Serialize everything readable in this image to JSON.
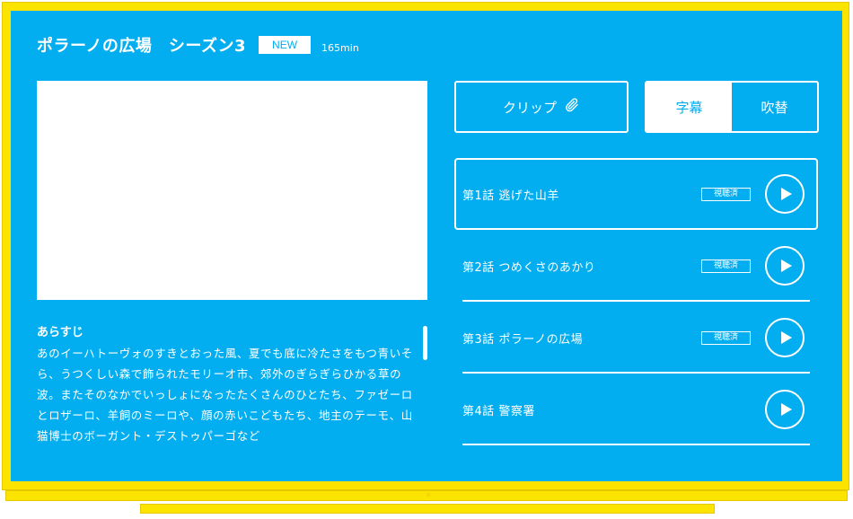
{
  "header": {
    "title": "ポラーノの広場　シーズン3",
    "badge": "NEW",
    "duration": "165min"
  },
  "synopsis": {
    "heading": "あらすじ",
    "body": "あのイーハトーヴォのすきとおった風、夏でも底に冷たさをもつ青いそら、うつくしい森で飾られたモリーオ市、郊外のぎらぎらひかる草の波。またそのなかでいっしょになったたくさんのひとたち、ファゼーロとロザーロ、羊飼のミーロや、顔の赤いこどもたち、地主のテーモ、山猫博士のボーガント・デストゥパーゴなど"
  },
  "controls": {
    "clip_label": "クリップ",
    "subtitle_label": "字幕",
    "dub_label": "吹替",
    "active_audio": "subtitle"
  },
  "episodes": [
    {
      "label": "第1話  逃げた山羊",
      "watched": "視聴済",
      "selected": true
    },
    {
      "label": "第2話  つめくさのあかり",
      "watched": "視聴済",
      "selected": false
    },
    {
      "label": "第3話  ポラーノの広場",
      "watched": "視聴済",
      "selected": false
    },
    {
      "label": "第4話  警察署",
      "watched": "",
      "selected": false
    }
  ],
  "colors": {
    "screen": "#02aeef",
    "bezel": "#fde400",
    "foreground": "#ffffff"
  },
  "icons": {
    "clip": "paperclip-icon",
    "play": "play-icon"
  }
}
